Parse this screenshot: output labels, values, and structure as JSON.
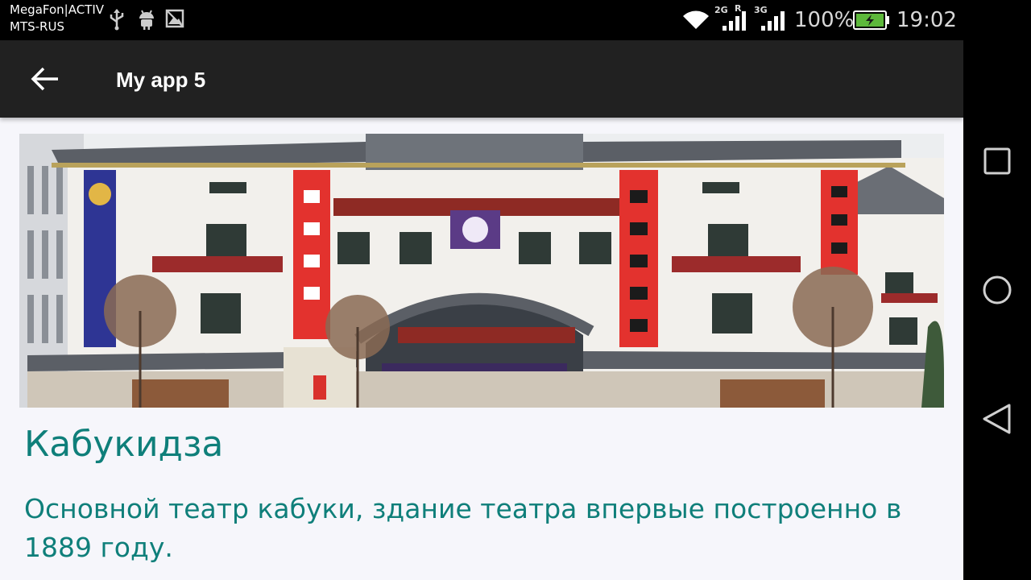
{
  "status_bar": {
    "carrier_line1": "MegaFon|ACTIV",
    "carrier_line2": "MTS-RUS",
    "icons": [
      "usb-icon",
      "android-debug-icon",
      "image-notification-icon",
      "wifi-icon",
      "signal-2g-icon",
      "signal-3g-icon",
      "battery-charging-icon"
    ],
    "net_2g": "2G",
    "net_r": "R",
    "net_3g": "3G",
    "battery_percent": "100%",
    "time": "19:02",
    "battery_level": 1.0
  },
  "app_bar": {
    "back_icon": "arrow-back-icon",
    "title": "My app 5",
    "background_color": "#212121"
  },
  "content": {
    "image_icon": "kabukiza-theatre-photo",
    "title": "Кабукидза",
    "description": "Основной театр кабуки, здание театра впервые построенно в 1889 году.",
    "accent_color": "#0f7f7a"
  },
  "nav_bar": {
    "recents_icon": "square-recents-icon",
    "home_icon": "circle-home-icon",
    "back_icon": "triangle-back-icon"
  }
}
